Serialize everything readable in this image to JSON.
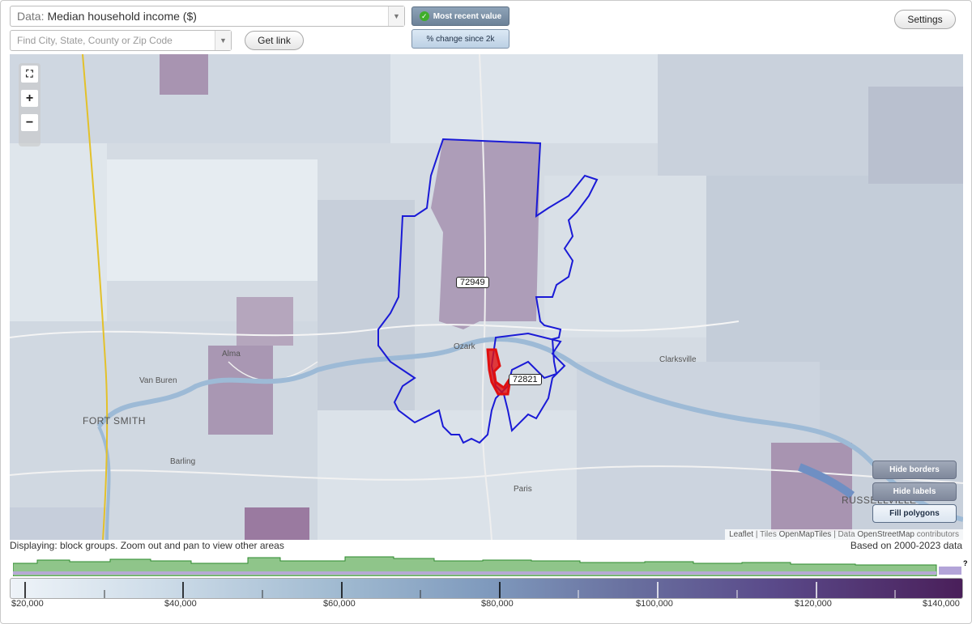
{
  "header": {
    "data_prefix": "Data:",
    "data_value": "Median household income ($)",
    "search_placeholder": "Find City, State, County or Zip Code",
    "get_link_label": "Get link",
    "most_recent_label": "Most recent value",
    "pct_change_label": "% change since 2k",
    "settings_label": "Settings"
  },
  "map": {
    "zoom_fit_icon": "fit-extent-icon",
    "zoom_in_label": "+",
    "zoom_out_label": "−",
    "place_labels": [
      "Alma",
      "Van Buren",
      "FORT SMITH",
      "Barling",
      "Ozark",
      "Clarksville",
      "Paris",
      "RUSSELLVILLE"
    ],
    "zip_labels": [
      "72949",
      "72821"
    ],
    "hide_borders_label": "Hide borders",
    "hide_labels_label": "Hide labels",
    "fill_polygons_label": "Fill polygons",
    "attribution": {
      "leaflet": "Leaflet",
      "tiles_prefix": "| Tiles",
      "tiles_source": "OpenMapTiles",
      "data_prefix": "| Data",
      "data_source": "OpenStreetMap",
      "data_suffix": "contributors"
    },
    "colors": {
      "boundary": "#1a1ad6",
      "highlight": "#e01010",
      "state_line": "#e3c12a"
    }
  },
  "footer": {
    "displaying": "Displaying: block groups. Zoom out and pan to view other areas",
    "based_on": "Based on 2000-2023 data",
    "question_mark": "?",
    "legend_labels": [
      "$20,000",
      "$40,000",
      "$60,000",
      "$80,000",
      "$100,000",
      "$120,000",
      "$140,000"
    ],
    "legend_min": 20000,
    "legend_max": 140000
  }
}
